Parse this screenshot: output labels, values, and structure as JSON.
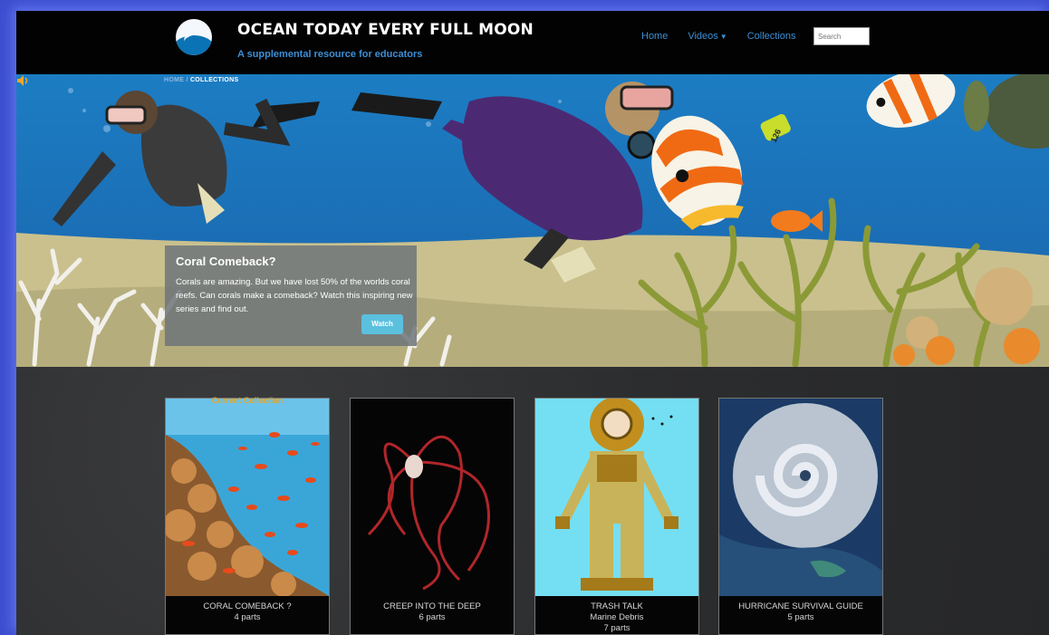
{
  "header": {
    "title": "OCEAN TODAY EVERY FULL MOON",
    "tagline": "A supplemental resource for educators",
    "nav": {
      "home": "Home",
      "videos": "Videos",
      "collections": "Collections"
    },
    "search_placeholder": "Search"
  },
  "breadcrumb": {
    "home": "HOME",
    "separator": "/",
    "current": "COLLECTIONS"
  },
  "feature": {
    "title": "Coral Comeback?",
    "text": "Corals are amazing. But we have lost 50% of the worlds coral reefs. Can corals make a comeback? Watch this inspiring new series and find out.",
    "button": "Watch"
  },
  "tag_label": "126",
  "collections": [
    {
      "title": "CORAL COMEBACK ?",
      "subtitle": "",
      "parts": "4 parts",
      "badge": "Current Collection"
    },
    {
      "title": "CREEP INTO THE DEEP",
      "subtitle": "",
      "parts": "6 parts"
    },
    {
      "title": "TRASH TALK",
      "subtitle": "Marine Debris",
      "parts": "7 parts"
    },
    {
      "title": "HURRICANE SURVIVAL GUIDE",
      "subtitle": "",
      "parts": "5 parts"
    }
  ],
  "colors": {
    "accent": "#3c8fd6",
    "button": "#5bc0de",
    "badge": "#e2a628",
    "outer": "#3d4fd0"
  },
  "icons": [
    "wave-logo-icon",
    "caret-down-icon",
    "speaker-icon"
  ]
}
